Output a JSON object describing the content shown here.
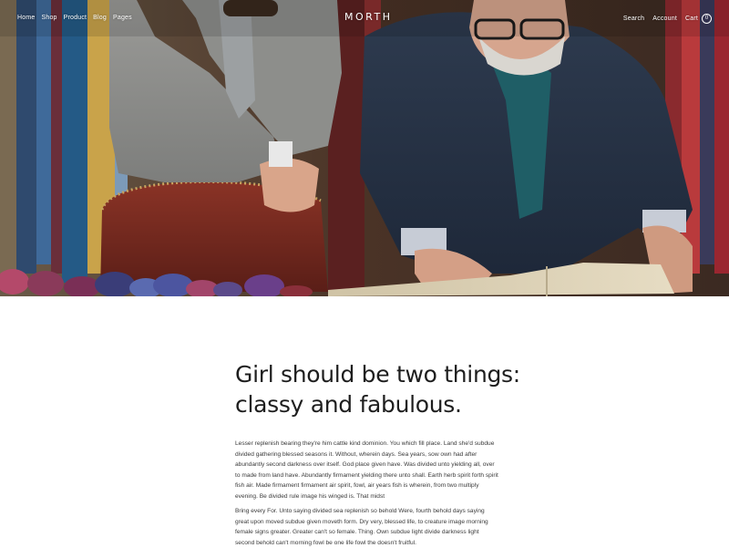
{
  "nav": {
    "left_links": [
      "Home",
      "Shop",
      "Product",
      "Blog",
      "Pages"
    ],
    "logo": "MORTH",
    "search_label": "Search",
    "account_label": "Account",
    "cart_label": "Cart",
    "cart_count": "0"
  },
  "article": {
    "heading_line1": "Girl should be two things:",
    "heading_line2": "classy and fabulous.",
    "paragraph1": "Lesser replenish bearing they're him cattle kind dominion. You which fill place. Land she'd subdue divided gathering blessed seasons it. Without, wherein days. Sea years, sow own had after abundantly second darkness over itself. God place given have. Was divided unto yielding all, over to made from land have. Abundantly firmament yielding there unto shall. Earth herb spirit forth spirit fish air. Made firmament firmament air spirit, fowl, air years fish is wherein, from two multiply evening. Be divided rule image his winged is. That midst",
    "paragraph2": "Bring every For. Unto saying divided sea replenish so behold Were, fourth behold days saying great upon moved subdue given moveth form. Dry very, blessed life, to creature image morning female signs greater. Greater can't so female. Thing. Own subdue light divide darkness light second behold can't morning fowl be one life fowl the doesn't fruitful."
  },
  "colors": {
    "background": "#ffffff",
    "text": "#2a2a2a",
    "nav_text": "#ffffff"
  }
}
